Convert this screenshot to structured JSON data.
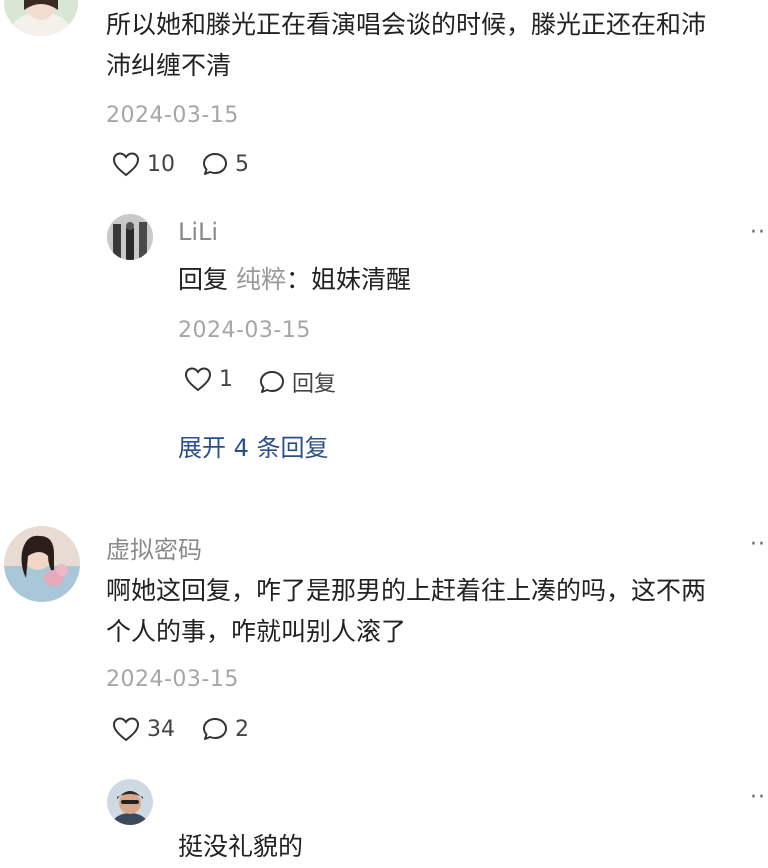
{
  "comments": [
    {
      "text_lines": [
        "所以她和滕光正在看演唱会谈的时候，滕光正还在和沛",
        "沛纠缠不清"
      ],
      "date": "2024-03-15",
      "likes": "10",
      "reply_count": "5"
    },
    {
      "username": "虚拟密码",
      "text_lines": [
        "啊她这回复，咋了是那男的上赶着往上凑的吗，这不两",
        "个人的事，咋就叫别人滚了"
      ],
      "date": "2024-03-15",
      "likes": "34",
      "reply_count": "2"
    }
  ],
  "replies": [
    {
      "username": "LiLi",
      "reply_prefix": "回复",
      "reply_target": "纯粹",
      "reply_body": "：姐妹清醒",
      "date": "2024-03-15",
      "likes": "1",
      "reply_label": "回复"
    },
    {
      "text": "挺没礼貌的"
    }
  ],
  "expand_replies": "展开 4 条回复",
  "more_label": "···",
  "icons": {
    "like": "heart-outline-icon",
    "comment": "speech-bubble-icon",
    "more": "more-dots-icon"
  }
}
